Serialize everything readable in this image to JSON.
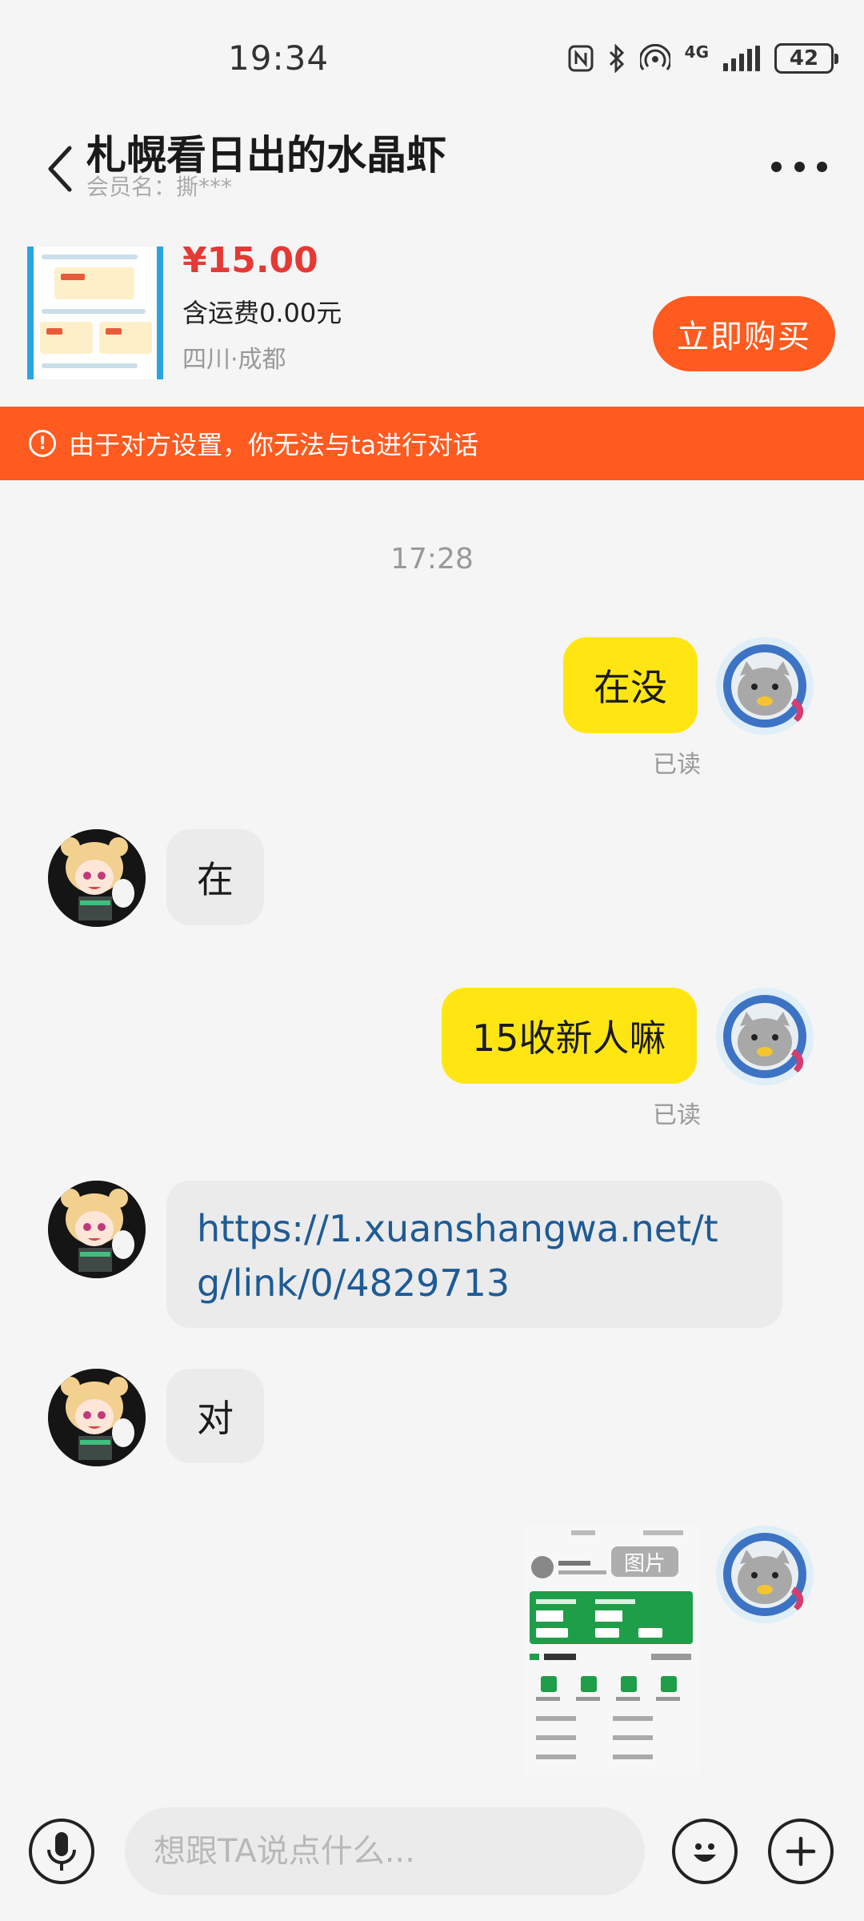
{
  "status_bar": {
    "time": "19:34",
    "network": "4G",
    "battery": "42",
    "icons": [
      "nfc-icon",
      "bluetooth-icon",
      "hotspot-icon",
      "signal-icon",
      "battery-icon"
    ]
  },
  "header": {
    "title": "札幌看日出的水晶虾",
    "subtitle": "会员名：撕***"
  },
  "product": {
    "price": "¥15.00",
    "shipping": "含运费0.00元",
    "location": "四川·成都",
    "buy_label": "立即购买"
  },
  "banner": {
    "text": "由于对方设置，你无法与ta进行对话"
  },
  "chat": {
    "timestamp": "17:28",
    "messages": [
      {
        "from": "me",
        "text": "在没",
        "status": "已读"
      },
      {
        "from": "them",
        "text": "在"
      },
      {
        "from": "me",
        "text": "15收新人嘛",
        "status": "已读"
      },
      {
        "from": "them",
        "text": "https://1.xuanshangwa.net/tg/link/0/4829713"
      },
      {
        "from": "them",
        "text": "对"
      },
      {
        "from": "me",
        "type": "image",
        "tag": "图片"
      }
    ]
  },
  "input": {
    "placeholder": "想跟TA说点什么..."
  },
  "colors": {
    "accent": "#ff5a1f",
    "my_bubble": "#ffe612",
    "their_bubble": "#ebebeb",
    "price": "#e53935",
    "link": "#1e5b96"
  }
}
